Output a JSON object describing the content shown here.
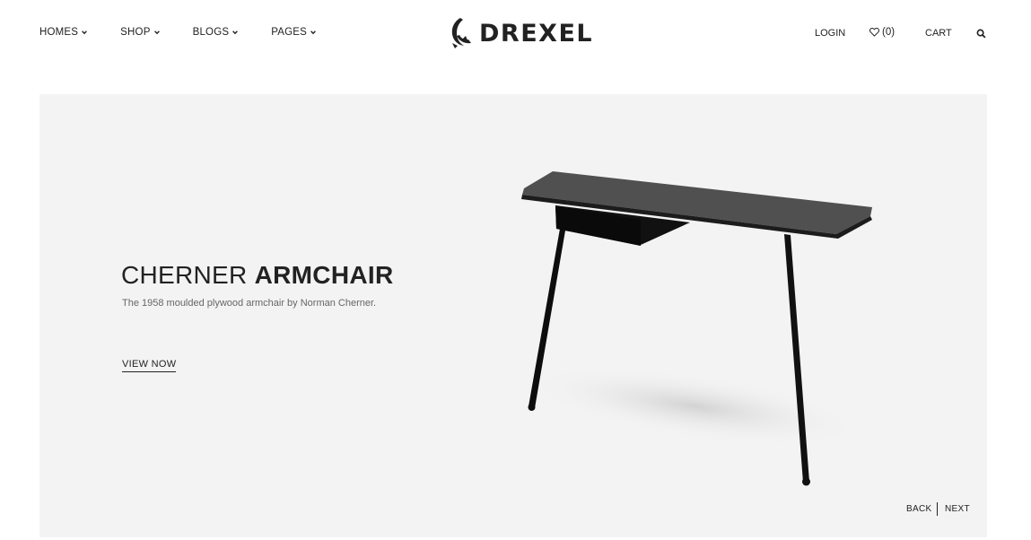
{
  "header": {
    "nav": [
      {
        "label": "HOMES"
      },
      {
        "label": "SHOP"
      },
      {
        "label": "BLOGS"
      },
      {
        "label": "PAGES"
      }
    ],
    "logo_text": "DREXEL",
    "login_label": "LOGIN",
    "wishlist_count": "(0)",
    "cart_label": "CART"
  },
  "hero": {
    "title_light": "CHERNER ",
    "title_bold": "ARMCHAIR",
    "subtitle": "The 1958 moulded plywood armchair by Norman Cherner.",
    "cta_label": "VIEW NOW",
    "back_label": "BACK",
    "next_label": "NEXT"
  },
  "icons": {
    "chevron": "chevron-down-icon",
    "heart": "heart-icon",
    "search": "search-icon",
    "logo": "logo-mark-icon"
  }
}
